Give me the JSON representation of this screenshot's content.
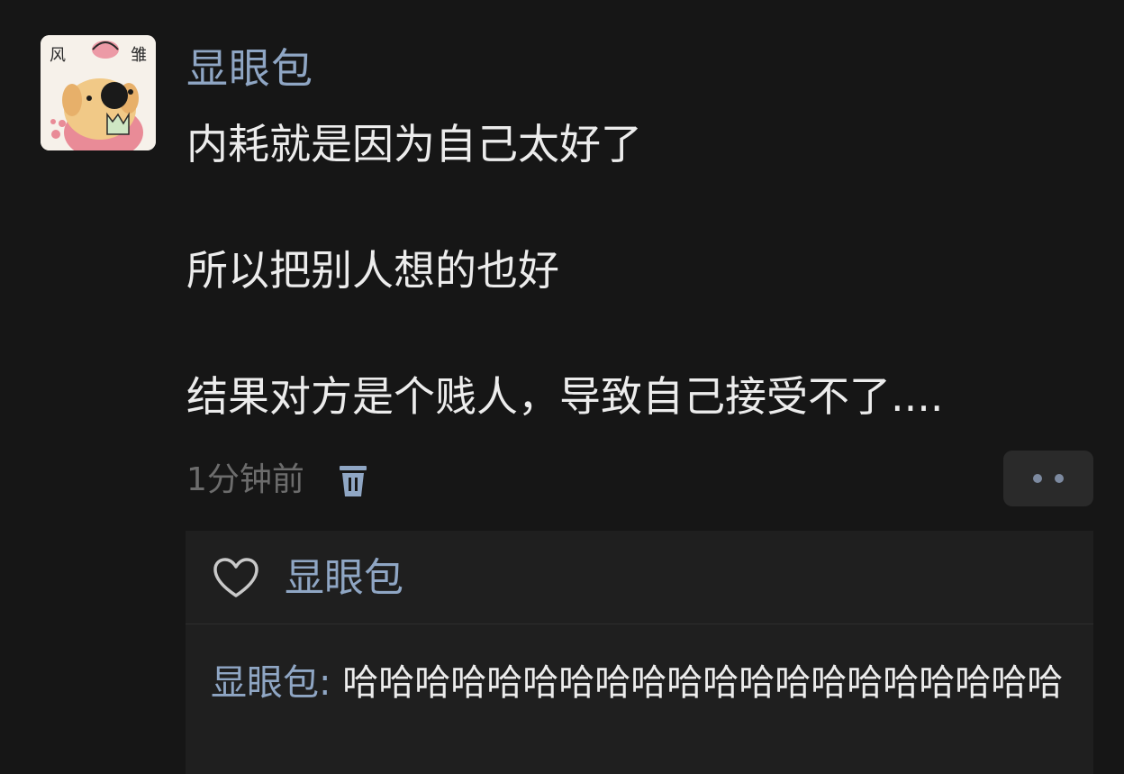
{
  "comment": {
    "username": "显眼包",
    "lines": [
      "内耗就是因为自己太好了",
      "所以把别人想的也好",
      "结果对方是个贱人，导致自己接受不了...."
    ],
    "time": "1分钟前"
  },
  "avatar": {
    "stamp_left": "风",
    "stamp_right": "雏"
  },
  "icons": {
    "delete": "trash-icon",
    "more": "more-dots-icon",
    "like": "heart-icon"
  },
  "reply_section": {
    "liked_by": "显眼包",
    "reply_author": "显眼包:",
    "reply_text": " 哈哈哈哈哈哈哈哈哈哈哈哈哈哈哈哈哈哈哈哈"
  },
  "colors": {
    "background": "#161616",
    "username": "#8fa6c4",
    "text": "#ececec",
    "muted": "#6c6c6c",
    "panel": "#1f1f1f"
  }
}
